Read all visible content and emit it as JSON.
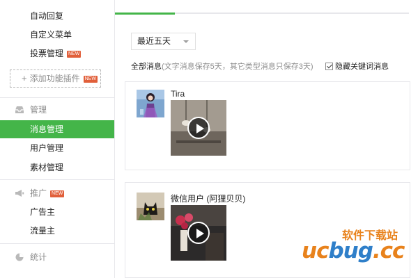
{
  "sidebar": {
    "items_top": [
      {
        "label": "自动回复"
      },
      {
        "label": "自定义菜单"
      },
      {
        "label": "投票管理",
        "badge": "NEW"
      }
    ],
    "add_plugin": {
      "icon": "plus-icon",
      "label": "添加功能插件",
      "badge": "NEW"
    },
    "groups": [
      {
        "icon": "tray-icon",
        "label": "管理",
        "items": [
          {
            "label": "消息管理",
            "active": true
          },
          {
            "label": "用户管理"
          },
          {
            "label": "素材管理"
          }
        ]
      },
      {
        "icon": "megaphone-icon",
        "label": "推广",
        "badge": "NEW",
        "items": [
          {
            "label": "广告主"
          },
          {
            "label": "流量主"
          }
        ]
      },
      {
        "icon": "pie-chart-icon",
        "label": "统计",
        "items": []
      }
    ]
  },
  "main": {
    "period_select": {
      "value": "最近五天"
    },
    "filter": {
      "all_label": "全部消息",
      "note": "(文字消息保存5天，其它类型消息只保存3天)",
      "hide_keyword": {
        "label": "隐藏关键词消息",
        "checked": true
      }
    },
    "messages": [
      {
        "sender": "Tira",
        "type": "video"
      },
      {
        "sender": "微信用户 (阿狸贝贝)",
        "type": "video"
      }
    ]
  },
  "watermark": {
    "cn": "软件下载站",
    "logo_1": "uc",
    "logo_2": "bug",
    "logo_3": ".cc"
  },
  "colors": {
    "accent": "#44b549",
    "badge": "#e15f3a",
    "border": "#e7e7eb",
    "watermark_orange": "#e8821c",
    "watermark_blue": "#2f7fc9"
  }
}
